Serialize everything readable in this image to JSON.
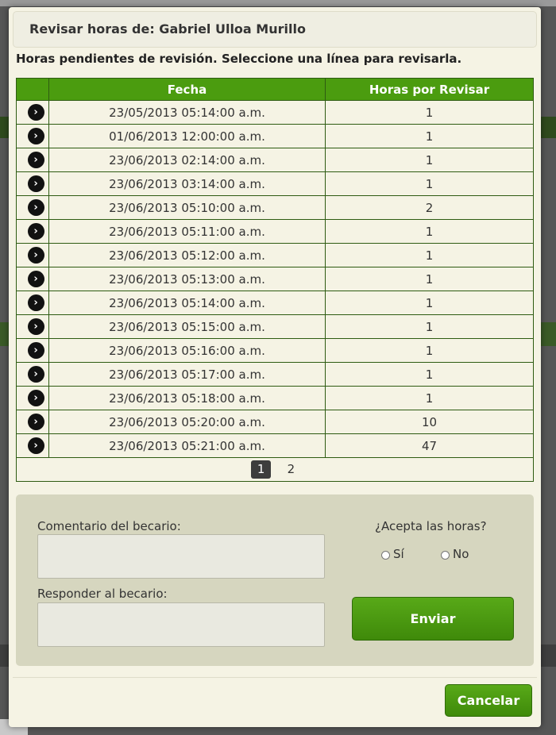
{
  "dialog": {
    "title": "Revisar horas de: Gabriel Ulloa Murillo",
    "instruction": "Horas pendientes de revisión. Seleccione una línea para revisarla."
  },
  "table": {
    "headers": [
      "",
      "Fecha",
      "Horas por Revisar"
    ],
    "rows": [
      {
        "fecha": "23/05/2013 05:14:00 a.m.",
        "horas": "1"
      },
      {
        "fecha": "01/06/2013 12:00:00 a.m.",
        "horas": "1"
      },
      {
        "fecha": "23/06/2013 02:14:00 a.m.",
        "horas": "1"
      },
      {
        "fecha": "23/06/2013 03:14:00 a.m.",
        "horas": "1"
      },
      {
        "fecha": "23/06/2013 05:10:00 a.m.",
        "horas": "2"
      },
      {
        "fecha": "23/06/2013 05:11:00 a.m.",
        "horas": "1"
      },
      {
        "fecha": "23/06/2013 05:12:00 a.m.",
        "horas": "1"
      },
      {
        "fecha": "23/06/2013 05:13:00 a.m.",
        "horas": "1"
      },
      {
        "fecha": "23/06/2013 05:14:00 a.m.",
        "horas": "1"
      },
      {
        "fecha": "23/06/2013 05:15:00 a.m.",
        "horas": "1"
      },
      {
        "fecha": "23/06/2013 05:16:00 a.m.",
        "horas": "1"
      },
      {
        "fecha": "23/06/2013 05:17:00 a.m.",
        "horas": "1"
      },
      {
        "fecha": "23/06/2013 05:18:00 a.m.",
        "horas": "1"
      },
      {
        "fecha": "23/06/2013 05:20:00 a.m.",
        "horas": "10"
      },
      {
        "fecha": "23/06/2013 05:21:00 a.m.",
        "horas": "47"
      }
    ],
    "row_icon": "arrow-right-circle-icon",
    "pager": {
      "pages": [
        "1",
        "2"
      ],
      "current": "1"
    }
  },
  "form": {
    "comentario_label": "Comentario del becario:",
    "comentario_value": "",
    "responder_label": "Responder al becario:",
    "responder_value": "",
    "acepta_label": "¿Acepta las horas?",
    "options": [
      "Sí",
      "No"
    ],
    "submit_label": "Enviar"
  },
  "footer": {
    "cancel_label": "Cancelar"
  },
  "colors": {
    "header_green": "#4b9c0f",
    "button_green": "#4a9a10",
    "dialog_bg": "#f5f3e4",
    "panel_bg": "#d6d6bf"
  }
}
